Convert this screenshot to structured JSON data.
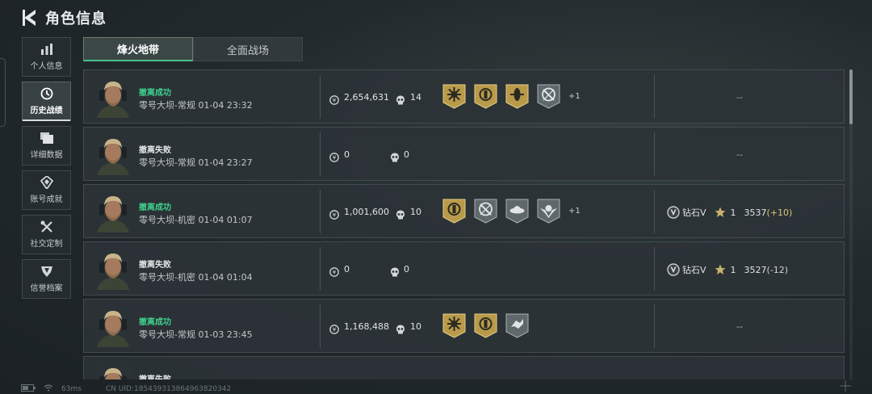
{
  "header": {
    "title": "角色信息"
  },
  "sidebar": {
    "items": [
      {
        "label": "个人信息",
        "icon": "bar-chart-icon",
        "active": false
      },
      {
        "label": "历史战绩",
        "icon": "history-icon",
        "active": true
      },
      {
        "label": "详细数据",
        "icon": "folder-icon",
        "active": false
      },
      {
        "label": "账号成就",
        "icon": "achievement-icon",
        "active": false
      },
      {
        "label": "社交定制",
        "icon": "tools-icon",
        "active": false
      },
      {
        "label": "信誉档案",
        "icon": "shield-icon",
        "active": false
      }
    ]
  },
  "tabs": [
    {
      "label": "烽火地带",
      "active": true
    },
    {
      "label": "全面战场",
      "active": false
    }
  ],
  "rows": [
    {
      "status": "撤离成功",
      "status_type": "success",
      "map": "零号大坝-常规 01-04 23:32",
      "coins": "2,654,631",
      "kills": "14",
      "badges": [
        "gold-sun-badge",
        "gold-crest-badge",
        "gold-pod-badge",
        "silver-crossed-badge"
      ],
      "more": "+1",
      "rank": null,
      "rank_empty": "--"
    },
    {
      "status": "撤离失败",
      "status_type": "fail",
      "map": "零号大坝-常规 01-04 23:27",
      "coins": "0",
      "kills": "0",
      "badges": [],
      "more": "",
      "rank": null,
      "rank_empty": "--"
    },
    {
      "status": "撤离成功",
      "status_type": "success",
      "map": "零号大坝-机密 01-04 01:07",
      "coins": "1,001,600",
      "kills": "10",
      "badges": [
        "gold-crest-badge",
        "silver-crossed-badge",
        "silver-disc-badge",
        "silver-wings-badge"
      ],
      "more": "+1",
      "rank": {
        "tier": "钻石V",
        "stars": "1",
        "score": "3537",
        "delta": "(+10)",
        "delta_type": "pos"
      }
    },
    {
      "status": "撤离失败",
      "status_type": "fail",
      "map": "零号大坝-机密 01-04 01:04",
      "coins": "0",
      "kills": "0",
      "badges": [],
      "more": "",
      "rank": {
        "tier": "钻石V",
        "stars": "1",
        "score": "3527",
        "delta": "(-12)",
        "delta_type": "neg"
      }
    },
    {
      "status": "撤离成功",
      "status_type": "success",
      "map": "零号大坝-常规 01-03 23:45",
      "coins": "1,168,488",
      "kills": "10",
      "badges": [
        "gold-sun-badge",
        "gold-crest-badge",
        "silver-bolt-badge"
      ],
      "more": "",
      "rank": null,
      "rank_empty": "--"
    },
    {
      "status": "撤离失败",
      "status_type": "fail",
      "map": "",
      "coins": "",
      "kills": "",
      "badges": [],
      "more": "",
      "rank": null,
      "rank_empty": ""
    }
  ],
  "footer": {
    "ping": "63ms",
    "uid": "CN UID:185439313864963820342"
  },
  "colors": {
    "success": "#3fd08e",
    "tab_accent": "#47c28e",
    "gold_badge": "#b99a4a",
    "silver_badge": "#5f696c"
  }
}
